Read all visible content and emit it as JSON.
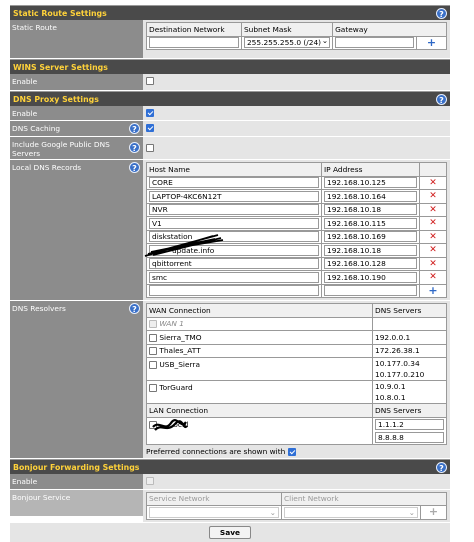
{
  "static_route": {
    "title": "Static Route Settings",
    "label": "Static Route",
    "headers": [
      "Destination Network",
      "Subnet Mask",
      "Gateway"
    ],
    "subnet_value": "255.255.255.0 (/24)"
  },
  "wins": {
    "title": "WINS Server Settings",
    "enable_label": "Enable"
  },
  "dns_proxy": {
    "title": "DNS Proxy Settings",
    "enable_label": "Enable",
    "caching_label": "DNS Caching",
    "google_label": "Include Google Public DNS Servers",
    "local_records_label": "Local DNS Records",
    "records_headers": [
      "Host Name",
      "IP Address"
    ],
    "records": [
      {
        "host": "CORE",
        "ip": "192.168.10.125"
      },
      {
        "host": "LAPTOP-4KC6N12T",
        "ip": "192.168.10.164"
      },
      {
        "host": "NVR",
        "ip": "192.168.10.18"
      },
      {
        "host": "V1",
        "ip": "192.168.10.115"
      },
      {
        "host": "diskstation",
        "ip": "192.168.10.169"
      },
      {
        "host": "update.info",
        "ip": "192.168.10.18"
      },
      {
        "host": "qbittorrent",
        "ip": "192.168.10.128"
      },
      {
        "host": "smc",
        "ip": "192.168.10.190"
      }
    ],
    "resolvers_label": "DNS Resolvers",
    "wan_header": "WAN Connection",
    "dns_servers_header": "DNS Servers",
    "wan_rows": [
      {
        "name": "WAN 1",
        "servers": [
          ""
        ],
        "disabled": true
      },
      {
        "name": "Sierra_TMO",
        "servers": [
          "192.0.0.1"
        ],
        "disabled": false
      },
      {
        "name": "Thales_ATT",
        "servers": [
          "172.26.38.1"
        ],
        "disabled": false
      },
      {
        "name": "USB_Sierra",
        "servers": [
          "10.177.0.34",
          "10.177.0.210"
        ],
        "disabled": false
      },
      {
        "name": "TorGuard",
        "servers": [
          "10.9.0.1",
          "10.8.0.1"
        ],
        "disabled": false
      }
    ],
    "lan_header": "LAN Connection",
    "lan_name": "ocal",
    "lan_servers": [
      "1.1.1.2",
      "8.8.8.8"
    ],
    "preferred_label": "Preferred connections are shown with"
  },
  "bonjour": {
    "title": "Bonjour Forwarding Settings",
    "enable_label": "Enable",
    "service_label": "Bonjour Service",
    "headers": [
      "Service Network",
      "Client Network"
    ]
  },
  "save_label": "Save",
  "help_glyph": "?",
  "delete_glyph": "✕",
  "add_glyph": "+",
  "dropdown_glyph": "⌄"
}
